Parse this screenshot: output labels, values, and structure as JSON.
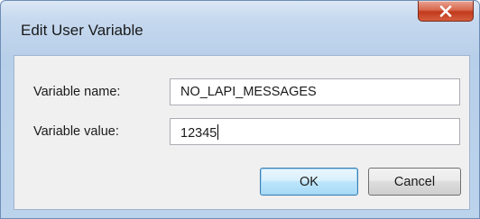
{
  "window": {
    "title": "Edit User Variable",
    "close_icon": "close-icon",
    "close_color": "#c13a1c"
  },
  "form": {
    "name_label": "Variable name:",
    "name_value": "NO_LAPI_MESSAGES",
    "value_label": "Variable value:",
    "value_value": "12345"
  },
  "buttons": {
    "ok_label": "OK",
    "cancel_label": "Cancel"
  }
}
